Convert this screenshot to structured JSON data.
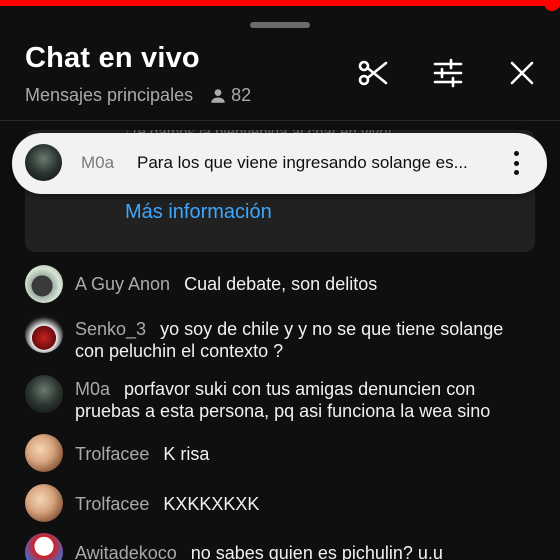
{
  "player": {
    "progress_percent": 98.5
  },
  "header": {
    "title": "Chat en vivo",
    "mode_label": "Mensajes principales",
    "viewer_count": "82",
    "icons": [
      "scissors-icon",
      "tune-sliders-icon",
      "close-icon"
    ]
  },
  "welcome": {
    "hidden_text": "¡Te damos la bienvenida al chat en vivo!",
    "link_label": "Más información"
  },
  "pinned": {
    "author": "M0a",
    "text": "Para los que viene ingresando solange es..."
  },
  "messages": [
    {
      "author": "A Guy Anon",
      "text": "Cual debate, son delitos"
    },
    {
      "author": "Senko_3",
      "text": "yo soy de chile y y no se que tiene solange con peluchin el contexto ?"
    },
    {
      "author": "M0a",
      "text": "porfavor suki con tus amigas denuncien con pruebas a esta persona, pq asi funciona la wea sino"
    },
    {
      "author": "Trolfacee",
      "text": "K risa"
    },
    {
      "author": "Trolfacee",
      "text": "KXKKXKXK"
    },
    {
      "author": "Awitadekoco",
      "text": "no sabes quien es pichulin? u.u"
    }
  ],
  "colors": {
    "background": "#0f0f0f",
    "accent_red": "#ff0000",
    "link_blue": "#3ea6ff",
    "pinned_bg": "#f2f2f2"
  }
}
